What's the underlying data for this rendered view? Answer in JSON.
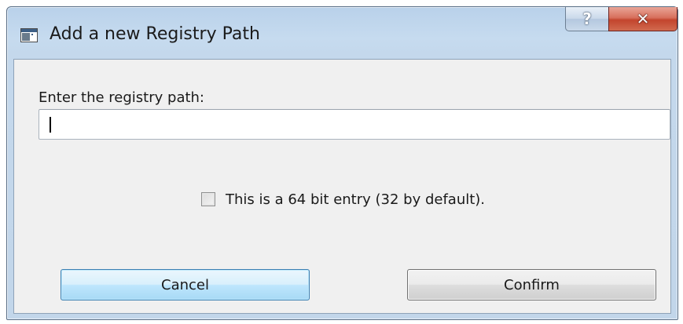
{
  "window": {
    "title": "Add a new Registry Path",
    "help_label": "?",
    "close_label": "✕"
  },
  "form": {
    "path_label": "Enter the registry path:",
    "path_value": "",
    "path_placeholder": "",
    "checkbox_label": "This is a 64 bit entry (32 by default).",
    "checkbox_checked": false
  },
  "buttons": {
    "cancel_label": "Cancel",
    "confirm_label": "Confirm"
  },
  "icons": {
    "app": "application-window-icon",
    "help": "help-icon",
    "close": "close-icon"
  },
  "colors": {
    "titlebar": "#c4d8ec",
    "client_bg": "#f0f0f0",
    "close_button": "#c3442d",
    "focused_button_border": "#3c7fb1"
  }
}
